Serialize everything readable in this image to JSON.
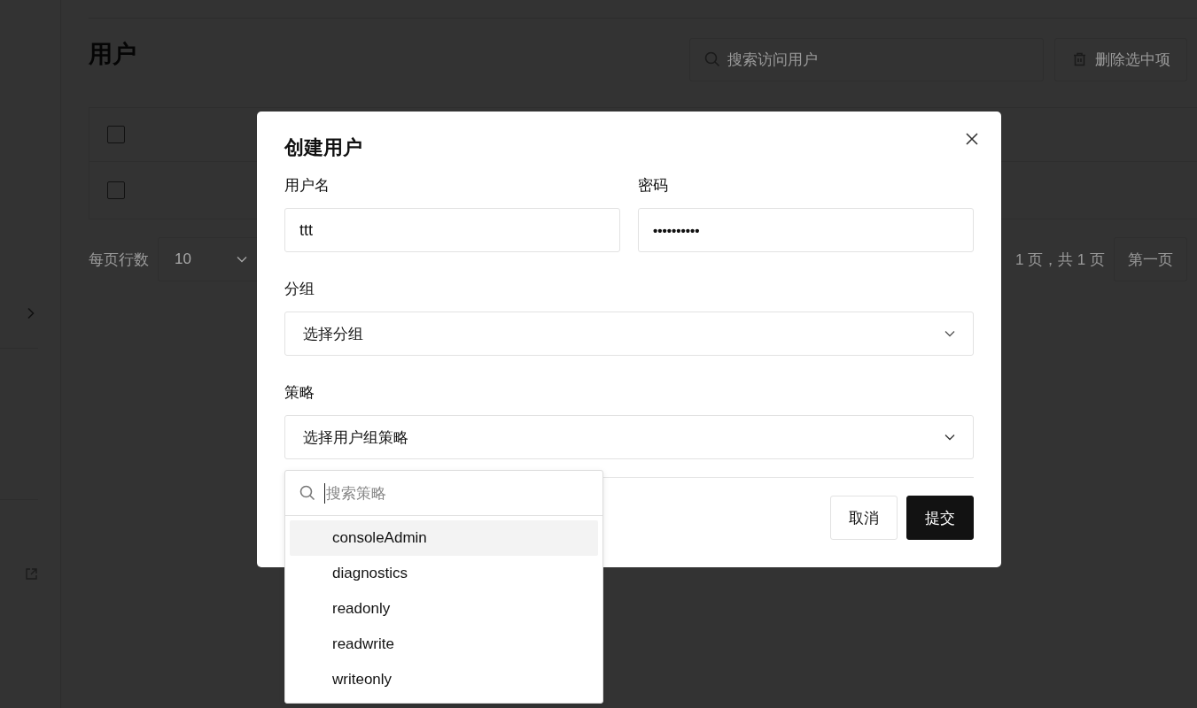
{
  "page": {
    "title": "用户",
    "search": {
      "placeholder": "搜索访问用户"
    },
    "delete_button": "删除选中项",
    "table": {
      "rows": [
        {
          "checked": false
        },
        {
          "checked": false
        }
      ]
    },
    "pagination": {
      "rows_per_page_label": "每页行数",
      "rows_per_page": "10",
      "page_info": "1 页，共 1 页",
      "first_button": "第一页"
    }
  },
  "dialog": {
    "title": "创建用户",
    "fields": [
      {
        "label": "用户名",
        "value": "ttt",
        "kind": "text"
      },
      {
        "label": "密码",
        "value": "••••••••••",
        "kind": "password"
      }
    ],
    "selects": [
      {
        "label": "分组",
        "placeholder": "选择分组",
        "expanded": false
      },
      {
        "label": "策略",
        "placeholder": "选择用户组策略",
        "expanded": true
      }
    ],
    "buttons": [
      {
        "label": "取消",
        "kind": "secondary"
      },
      {
        "label": "提交",
        "kind": "primary"
      }
    ]
  },
  "policy_dropdown": {
    "search": {
      "placeholder": "搜索策略"
    },
    "options": [
      {
        "label": "consoleAdmin",
        "highlighted": true
      },
      {
        "label": "diagnostics",
        "highlighted": false
      },
      {
        "label": "readonly",
        "highlighted": false
      },
      {
        "label": "readwrite",
        "highlighted": false
      },
      {
        "label": "writeonly",
        "highlighted": false
      }
    ]
  }
}
